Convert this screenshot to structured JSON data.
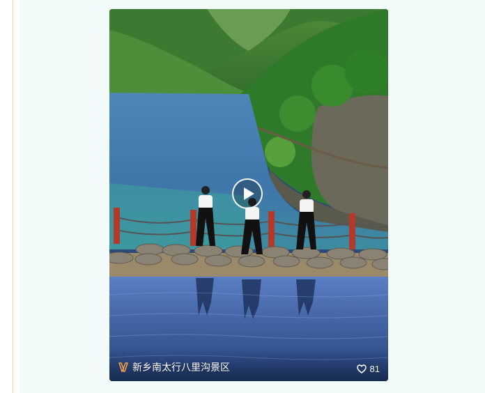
{
  "post": {
    "location_icon": "location-bookmark-icon",
    "location_name": "新乡南太行八里沟景区",
    "like_icon": "heart-icon",
    "like_count": "81",
    "play_icon": "play-icon"
  },
  "colors": {
    "panel_background": "#f2fbfa",
    "left_rule": "#e8dca8",
    "location_icon": "#f0a24a",
    "text_on_video": "#ffffff"
  }
}
